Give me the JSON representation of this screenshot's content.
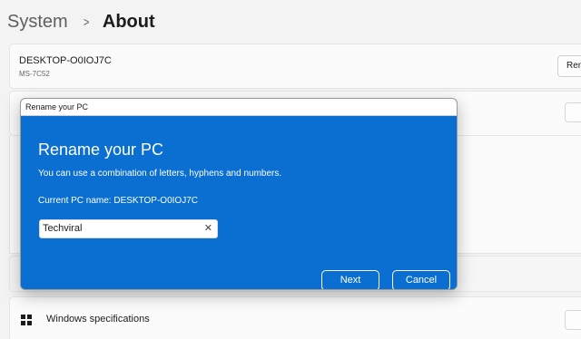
{
  "breadcrumb": {
    "parent": "System",
    "separator": ">",
    "current": "About"
  },
  "device": {
    "name": "DESKTOP-O0IOJ7C",
    "model": "MS-7C52",
    "rename_button_label": "Ren"
  },
  "windows_spec": {
    "label": "Windows specifications",
    "icon": "windows-logo-icon"
  },
  "dialog": {
    "window_title": "Rename your PC",
    "heading": "Rename your PC",
    "description": "You can use a combination of letters, hyphens and numbers.",
    "current_name_label": "Current PC name: DESKTOP-O0IOJ7C",
    "input_value": "Techviral",
    "clear_icon": "close-icon",
    "next_label": "Next",
    "cancel_label": "Cancel",
    "accent_color": "#0a6fd1"
  }
}
